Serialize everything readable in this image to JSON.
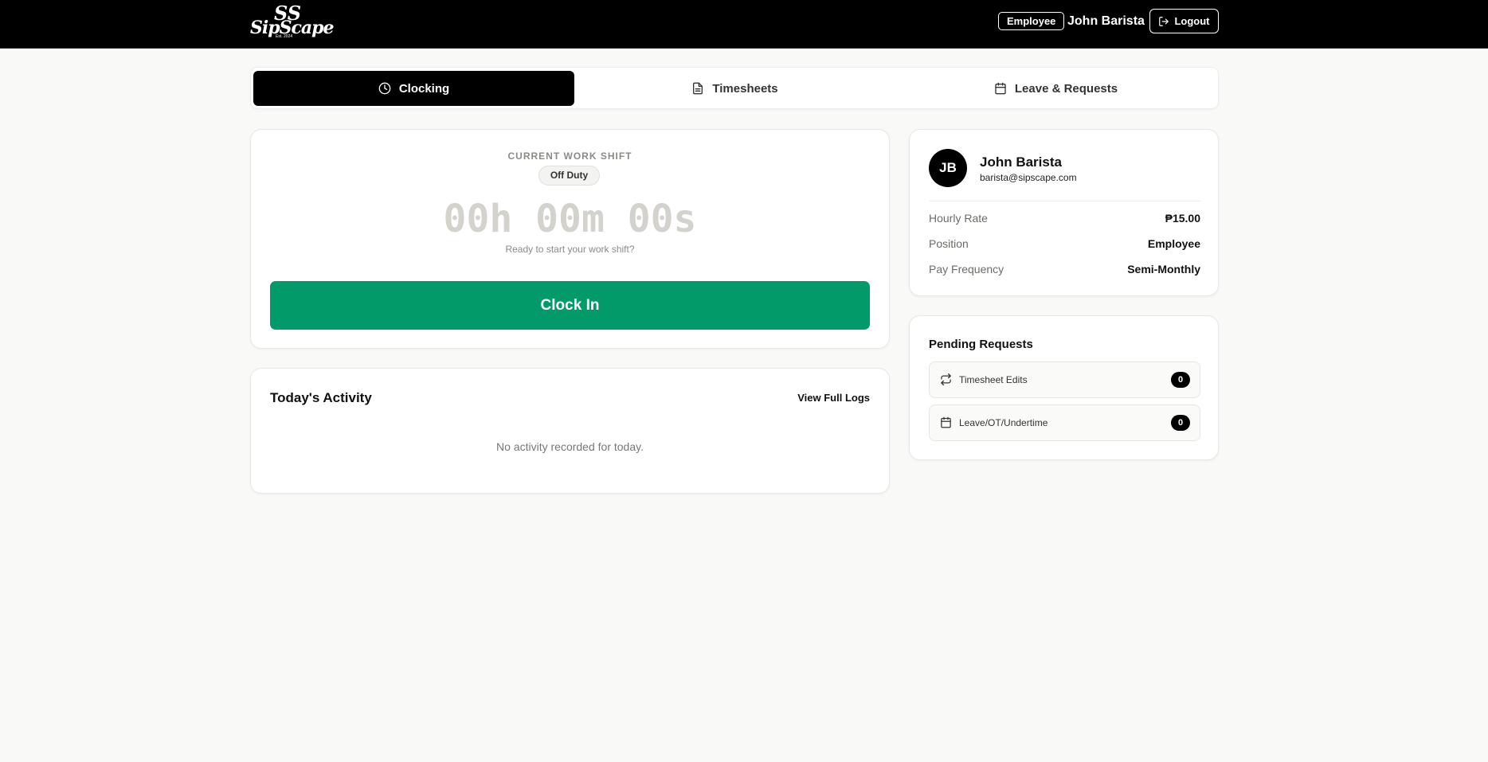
{
  "header": {
    "logo": {
      "word": "SipScape",
      "est": "Est. 2024"
    },
    "role_badge": "Employee",
    "user_name": "John Barista",
    "logout_label": "Logout"
  },
  "tabs": [
    {
      "label": "Clocking",
      "icon": "clock-icon",
      "active": true
    },
    {
      "label": "Timesheets",
      "icon": "document-icon",
      "active": false
    },
    {
      "label": "Leave & Requests",
      "icon": "calendar-icon",
      "active": false
    }
  ],
  "shift": {
    "label": "CURRENT WORK SHIFT",
    "status": "Off Duty",
    "timer": "00h 00m 00s",
    "hint": "Ready to start your work shift?",
    "clock_in_label": "Clock In"
  },
  "activity": {
    "title": "Today's Activity",
    "view_logs_label": "View Full Logs",
    "empty_text": "No activity recorded for today."
  },
  "profile": {
    "initials": "JB",
    "name": "John Barista",
    "email": "barista@sipscape.com",
    "rows": [
      {
        "key": "Hourly Rate",
        "value": "₱15.00"
      },
      {
        "key": "Position",
        "value": "Employee"
      },
      {
        "key": "Pay Frequency",
        "value": "Semi-Monthly"
      }
    ]
  },
  "pending": {
    "title": "Pending Requests",
    "items": [
      {
        "label": "Timesheet Edits",
        "count": "0",
        "icon": "swap-arrows-icon"
      },
      {
        "label": "Leave/OT/Undertime",
        "count": "0",
        "icon": "calendar-icon"
      }
    ]
  },
  "colors": {
    "accent_green": "#039a6a",
    "topbar": "#000000",
    "timer_muted": "#d4d2cd"
  }
}
